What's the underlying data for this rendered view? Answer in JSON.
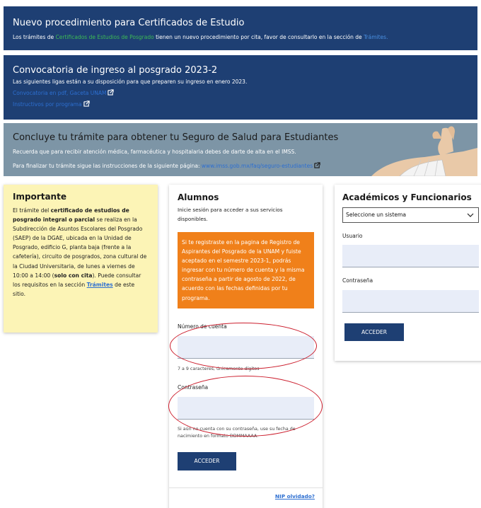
{
  "banners": {
    "b1": {
      "title": "Nuevo procedimiento para Certificados de Estudio",
      "text_before": "Los trámites de ",
      "link1": "Certificados de Estudios de Posgrado",
      "text_mid": " tienen un nuevo procedimiento por cita, favor de consultarlo en la sección de ",
      "link2": "Trámites."
    },
    "b2": {
      "title": "Convocatoria de ingreso al posgrado 2023-2",
      "text": "Las siguientes ligas están a su disposición para que preparen su ingreso en enero 2023.",
      "link1": "Convocatoria en pdf, Gaceta UNAM",
      "link2": "Instructivos por programa"
    },
    "b3": {
      "title": "Concluye tu trámite para obtener tu Seguro de Salud para Estudiantes",
      "text1": "Recuerda que para recibir atención médica, farmacéutica y hospitalaria debes de darte de alta en el IMSS.",
      "text2": "Para finalizar tu trámite sigue las instrucciones de la siguiente página: ",
      "link": "www.imss.gob.mx/faq/seguro-estudiantes"
    }
  },
  "importante": {
    "title": "Importante",
    "p1": "El trámite del ",
    "b1": "certificado de estudios de posgrado integral o parcial",
    "p2": " se realiza en la Subdirección de Asuntos Escolares del Posgrado (SAEP) de la DGAE, ubicada en la Unidad de Posgrado, edificio G, planta baja (frente a la cafetería), circuito de posgrados, zona cultural de la Ciudad Universitaria, de lunes a viernes de 10:00 a 14:00 (",
    "b2": "solo con cita",
    "p3": "). Puede consultar los requisitos en la sección ",
    "link": "Trámites",
    "p4": " de este sitio."
  },
  "alumnos": {
    "title": "Alumnos",
    "intro": "Inicie sesión para acceder a sus servicios disponibles.",
    "notice": "Si te registraste en la pagina de Registro de Aspirantes del Posgrado de la UNAM y fuiste aceptado en el semestre 2023-1, podrás ingresar con tu número de cuenta y la misma contraseña a partir de agosto de 2022, de acuerdo con las fechas definidas por tu programa.",
    "cuenta_label": "Número de cuenta",
    "cuenta_value": "",
    "cuenta_hint": "7 a 9 caracteres, únicamente dígitos",
    "pass_label": "Contraseña",
    "pass_value": "",
    "pass_hint": "Si aún no cuenta con su contraseña, use su fecha de nacimiento en formato DDMMAAAA.",
    "submit": "ACCEDER",
    "nip": "NIP olvidado?"
  },
  "academicos": {
    "title": "Académicos y Funcionarios",
    "select": "Seleccione un sistema",
    "user_label": "Usuario",
    "user_value": "",
    "pass_label": "Contraseña",
    "pass_value": "",
    "submit": "ACCEDER"
  },
  "colors": {
    "banner_navy": "#1e3f73",
    "banner_gray": "#7d95a6",
    "orange": "#f0801a",
    "note_yellow": "#fcf4b6",
    "annotation_red": "#cc1f2e"
  }
}
